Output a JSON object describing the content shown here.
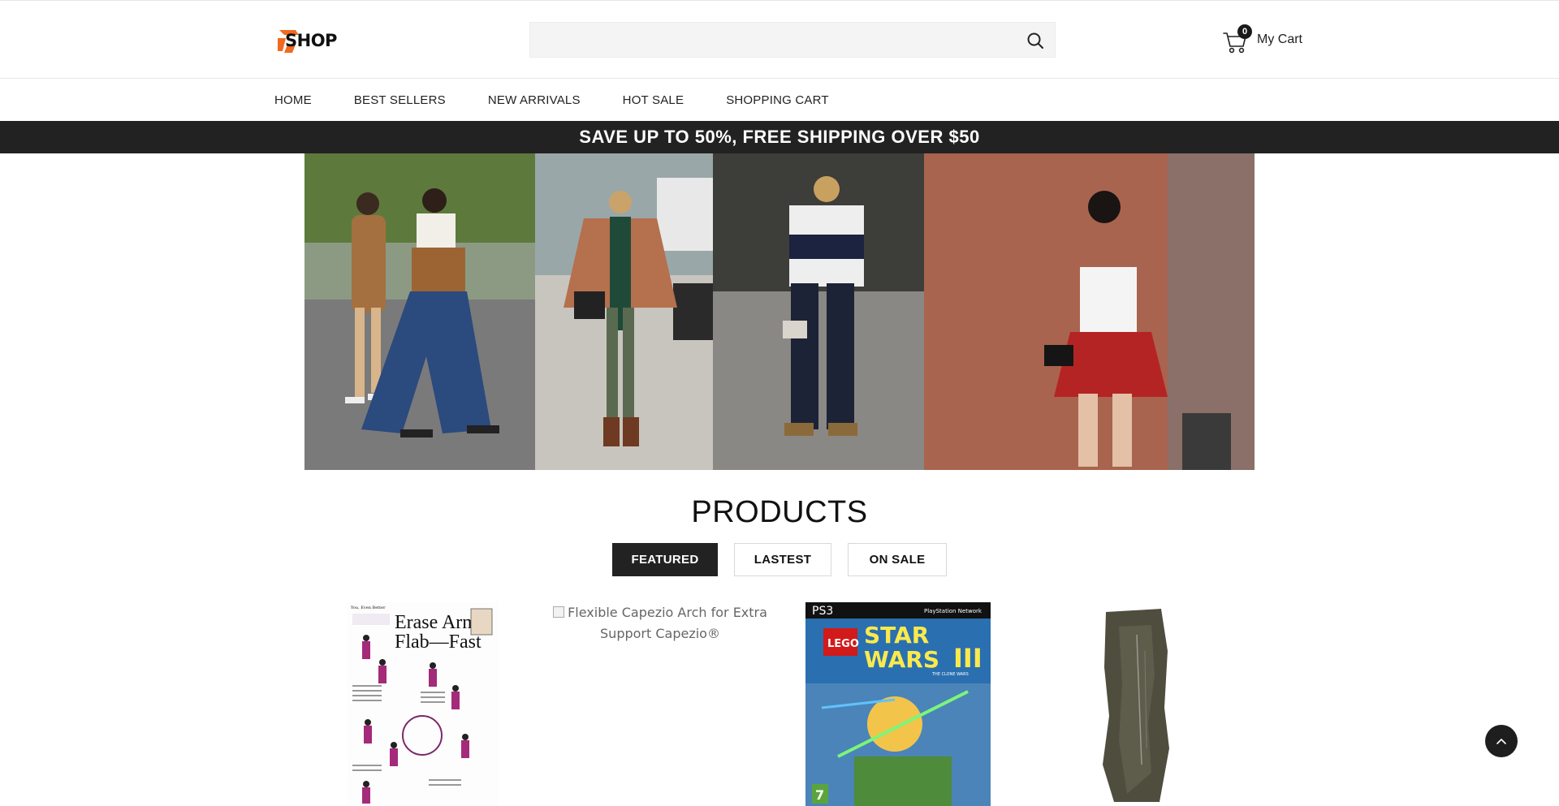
{
  "header": {
    "logo_text": "SHOP",
    "search_placeholder": "",
    "search_icon": "search-icon",
    "cart_count": "0",
    "cart_label": "My Cart",
    "cart_icon": "cart-icon"
  },
  "nav": {
    "items": [
      "HOME",
      "BEST SELLERS",
      "NEW ARRIVALS",
      "HOT SALE",
      "SHOPPING CART"
    ]
  },
  "promo": {
    "text": "SAVE UP TO 50%, FREE SHIPPING OVER $50"
  },
  "products": {
    "title": "PRODUCTS",
    "tabs": [
      "FEATURED",
      "LASTEST",
      "ON SALE"
    ],
    "active_tab": "FEATURED",
    "items": [
      {
        "magazine_kicker": "You, Even Better",
        "magazine_title_line1": "Erase Arm",
        "magazine_title_line2": "Flab—Fast"
      },
      {
        "alt_text": "Flexible Capezio Arch for Extra Support Capezio®"
      },
      {
        "platform": "PS3",
        "network": "PlayStation Network",
        "brand": "LEGO",
        "title_line1": "STAR",
        "title_line2": "WARS",
        "title_numeral": "III",
        "subtitle": "THE CLONE WARS",
        "rating": "7"
      },
      {}
    ]
  },
  "colors": {
    "promo_bg": "#222222",
    "active_tab_bg": "#222222",
    "logo_orange": "#f06a1f"
  },
  "back_to_top_icon": "chevron-up-icon"
}
